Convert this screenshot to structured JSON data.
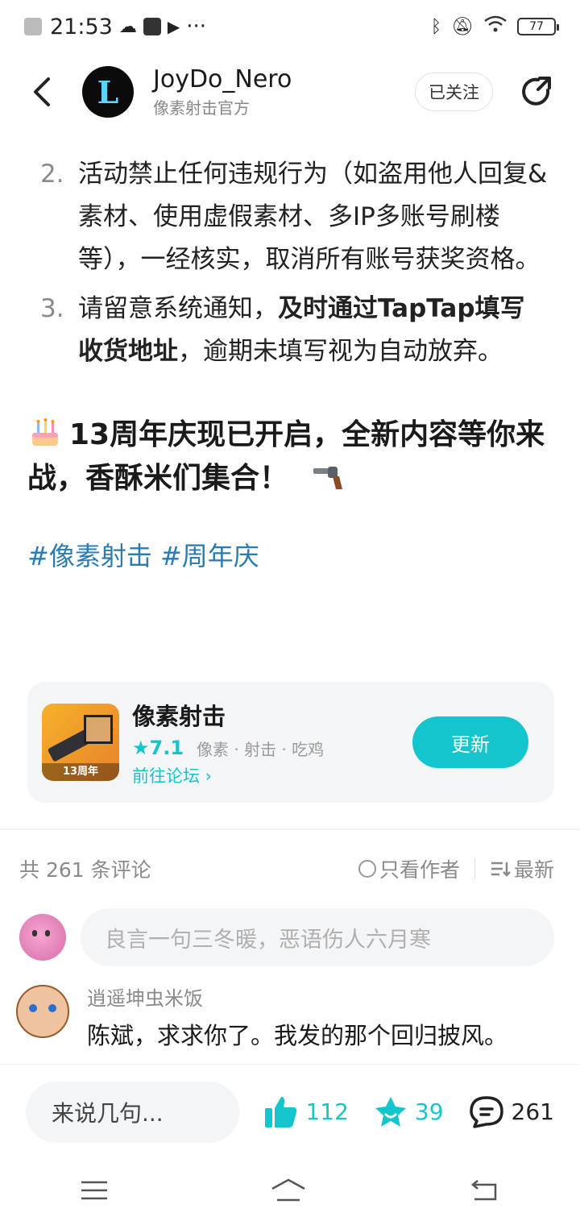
{
  "status_bar": {
    "time": "21:53",
    "dots": "···",
    "battery": "77"
  },
  "header": {
    "author_name": "JoyDo_Nero",
    "author_subtitle": "像素射击官方",
    "avatar_letter": "L",
    "follow_label": "已关注"
  },
  "article": {
    "items": [
      {
        "num": "2.",
        "text": "活动禁止任何违规行为（如盗用他人回复&素材、使用虚假素材、多IP多账号刷楼等），一经核实，取消所有账号获奖资格。"
      },
      {
        "num": "3.",
        "text_a": "请留意系统通知，",
        "text_bold": "及时通过TapTap填写收货地址",
        "text_b": "，逾期未填写视为自动放弃。"
      }
    ],
    "headline": "13周年庆现已开启，全新内容等你来战，香酥米们集合！",
    "tags": "#像素射击 #周年庆"
  },
  "app_card": {
    "name": "像素射击",
    "rating": "★7.1",
    "tags": "像素 · 射击 · 吃鸡",
    "forum_link": "前往论坛 ›",
    "icon_badge": "13周年",
    "update_label": "更新"
  },
  "comments": {
    "count_label": "共 261 条评论",
    "author_only_label": "只看作者",
    "sort_label": "最新",
    "input_placeholder": "良言一句三冬暖，恶语伤人六月寒",
    "items": [
      {
        "user": "逍遥坤虫米饭",
        "text": "陈斌，求求你了。我发的那个回归披风。"
      }
    ]
  },
  "action_bar": {
    "say_placeholder": "来说几句...",
    "likes": "112",
    "favorites": "39",
    "comments": "261"
  },
  "colors": {
    "accent": "#15c5ce",
    "tag": "#2a7bb2",
    "muted": "#8a8a8a"
  }
}
